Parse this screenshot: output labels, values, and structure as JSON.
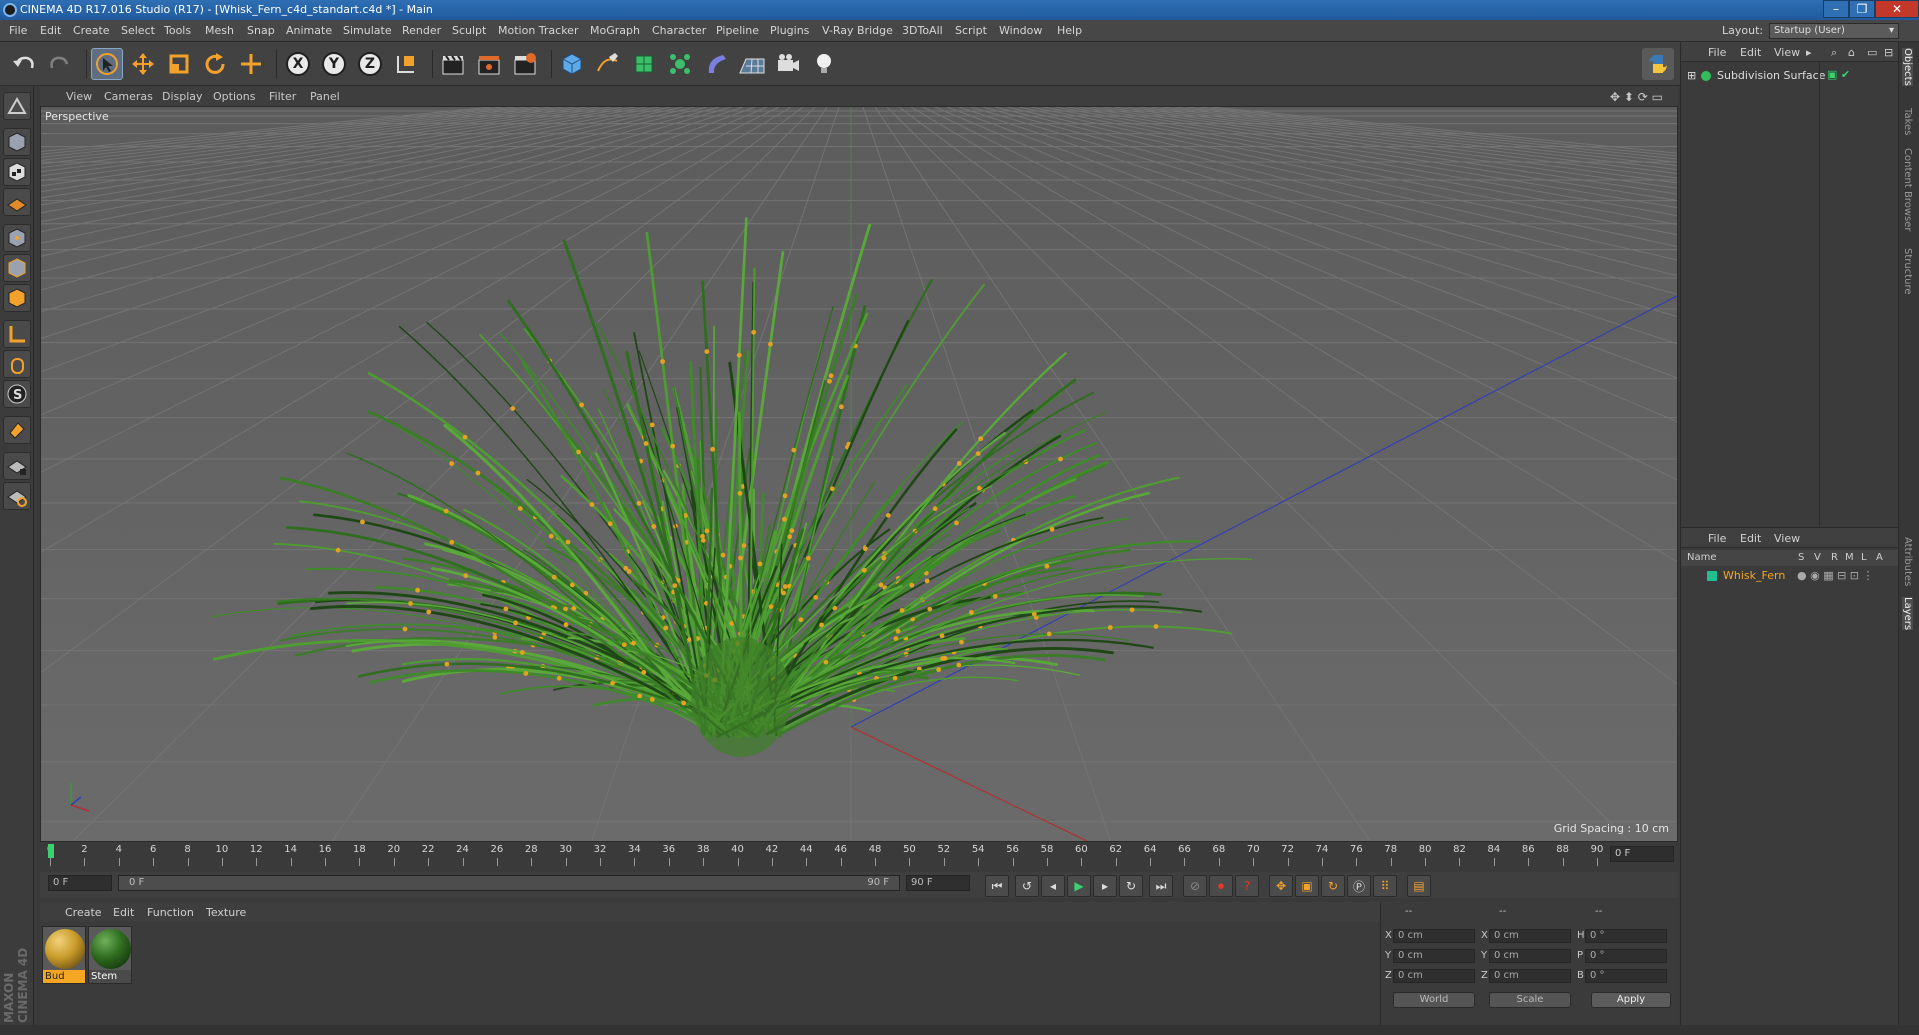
{
  "window": {
    "title": "CINEMA 4D R17.016 Studio (R17) - [Whisk_Fern_c4d_standart.c4d *] - Main",
    "controls": [
      "–",
      "❐",
      "✕"
    ]
  },
  "menubar": {
    "items": [
      "File",
      "Edit",
      "Create",
      "Select",
      "Tools",
      "Mesh",
      "Snap",
      "Animate",
      "Simulate",
      "Render",
      "Sculpt",
      "Motion Tracker",
      "MoGraph",
      "Character",
      "Pipeline",
      "Plugins",
      "V-Ray Bridge",
      "3DToAll",
      "Script",
      "Window",
      "Help"
    ],
    "layout_label": "Layout:",
    "layout_value": "Startup (User)"
  },
  "toolbar": {
    "axis_labels": [
      "X",
      "Y",
      "Z"
    ]
  },
  "viewport": {
    "menu": [
      "View",
      "Cameras",
      "Display",
      "Options",
      "Filter",
      "Panel"
    ],
    "camera_label": "Perspective",
    "grid_spacing": "Grid Spacing : 10 cm"
  },
  "timeline": {
    "ticks": [
      "0",
      "2",
      "4",
      "6",
      "8",
      "10",
      "12",
      "14",
      "16",
      "18",
      "20",
      "22",
      "24",
      "26",
      "28",
      "30",
      "32",
      "34",
      "36",
      "38",
      "40",
      "42",
      "44",
      "46",
      "48",
      "50",
      "52",
      "54",
      "56",
      "58",
      "60",
      "62",
      "64",
      "66",
      "68",
      "70",
      "72",
      "74",
      "76",
      "78",
      "80",
      "82",
      "84",
      "86",
      "88",
      "90"
    ],
    "current_frame": "0 F"
  },
  "transport": {
    "start_field": "0 F",
    "range_start": "0 F",
    "range_end": "90 F",
    "end_field": "90 F"
  },
  "material_manager": {
    "menu": [
      "Create",
      "Edit",
      "Function",
      "Texture"
    ],
    "materials": [
      {
        "name": "Bud",
        "color": "#c89a2a"
      },
      {
        "name": "Stem",
        "color": "#2e6b1e"
      }
    ]
  },
  "coordinates": {
    "headers": [
      "--",
      "--",
      "--"
    ],
    "rows": [
      {
        "a": "X",
        "av": "0 cm",
        "b": "X",
        "bv": "0 cm",
        "c": "H",
        "cv": "0 °"
      },
      {
        "a": "Y",
        "av": "0 cm",
        "b": "Y",
        "bv": "0 cm",
        "c": "P",
        "cv": "0 °"
      },
      {
        "a": "Z",
        "av": "0 cm",
        "b": "Z",
        "bv": "0 cm",
        "c": "B",
        "cv": "0 °"
      }
    ],
    "mode_world": "World",
    "mode_scale": "Scale",
    "apply": "Apply"
  },
  "object_manager": {
    "menu": [
      "File",
      "Edit",
      "View"
    ],
    "objects": [
      {
        "name": "Subdivision Surface"
      }
    ]
  },
  "layer_manager": {
    "menu": [
      "File",
      "Edit",
      "View"
    ],
    "columns": [
      "Name",
      "S",
      "V",
      "R",
      "M",
      "L",
      "A"
    ],
    "layers": [
      {
        "name": "Whisk_Fern",
        "color": "#1fbf8f"
      }
    ]
  },
  "right_tabs": [
    "Objects",
    "Takes",
    "Content Browser",
    "Structure",
    "Attributes",
    "Layers"
  ],
  "branding": "MAXON CINEMA 4D",
  "colors": {
    "accent_orange": "#f5a623",
    "selection_blue": "#8aa6c4",
    "titlebar_blue": "#2a66aa"
  }
}
